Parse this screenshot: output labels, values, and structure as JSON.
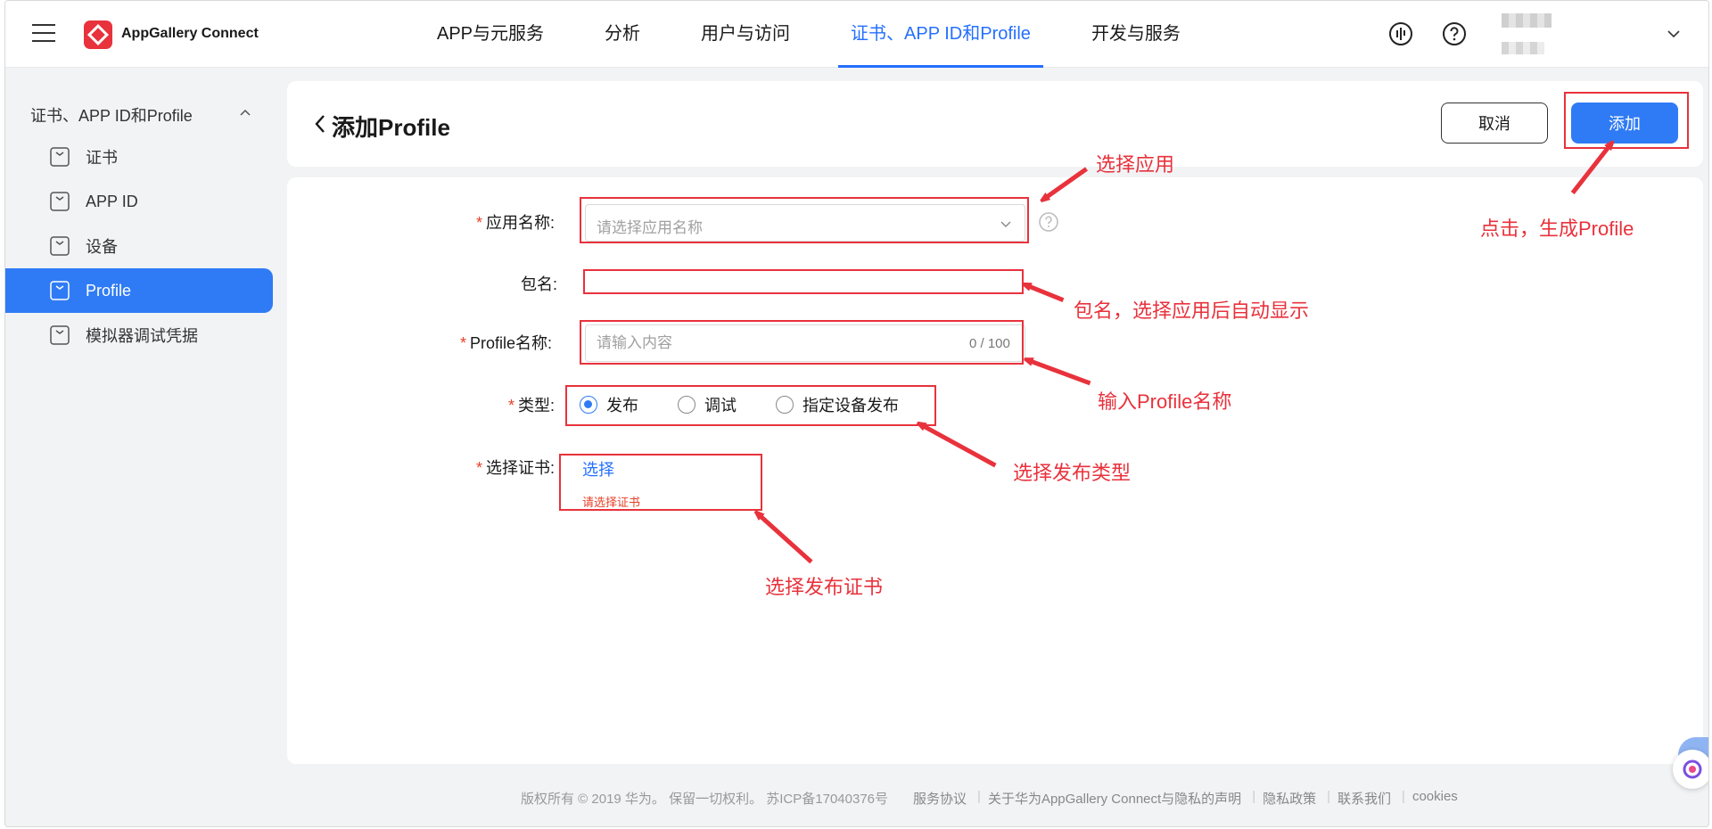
{
  "header": {
    "brand": "AppGallery Connect",
    "nav": [
      {
        "label": "APP与元服务",
        "active": false
      },
      {
        "label": "分析",
        "active": false
      },
      {
        "label": "用户与访问",
        "active": false
      },
      {
        "label": "证书、APP ID和Profile",
        "active": true
      },
      {
        "label": "开发与服务",
        "active": false
      }
    ],
    "icons": [
      "menu-icon",
      "logo-icon",
      "voice-icon",
      "help-icon",
      "chevron-down-icon"
    ],
    "accent": "#256fff"
  },
  "sidebar": {
    "group_label": "证书、APP ID和Profile",
    "items": [
      {
        "label": "证书",
        "active": false
      },
      {
        "label": "APP ID",
        "active": false
      },
      {
        "label": "设备",
        "active": false
      },
      {
        "label": "Profile",
        "active": true
      },
      {
        "label": "模拟器调试凭据",
        "active": false
      }
    ]
  },
  "page": {
    "title": "添加Profile",
    "cancel_label": "取消",
    "add_label": "添加"
  },
  "form": {
    "required_mark": "*",
    "app_name_label": "应用名称:",
    "app_name_placeholder": "请选择应用名称",
    "package_label": "包名:",
    "package_value": "",
    "profile_name_label": "Profile名称:",
    "profile_name_placeholder": "请输入内容",
    "profile_name_counter": "0 / 100",
    "type_label": "类型:",
    "type_options": [
      {
        "label": "发布",
        "checked": true
      },
      {
        "label": "调试",
        "checked": false
      },
      {
        "label": "指定设备发布",
        "checked": false
      }
    ],
    "cert_label": "选择证书:",
    "cert_link": "选择",
    "cert_error": "请选择证书"
  },
  "annotations": {
    "select_app": "选择应用",
    "package_auto": "包名，选择应用后自动显示",
    "enter_profile": "输入Profile名称",
    "select_type": "选择发布类型",
    "select_cert": "选择发布证书",
    "click_generate": "点击，生成Profile",
    "color": "#e8323c"
  },
  "footer": {
    "copyright": "版权所有 © 2019 华为。 保留一切权利。 苏ICP备17040376号",
    "links": [
      "服务协议",
      "关于华为AppGallery Connect与隐私的声明",
      "隐私政策",
      "联系我们",
      "cookies"
    ]
  }
}
